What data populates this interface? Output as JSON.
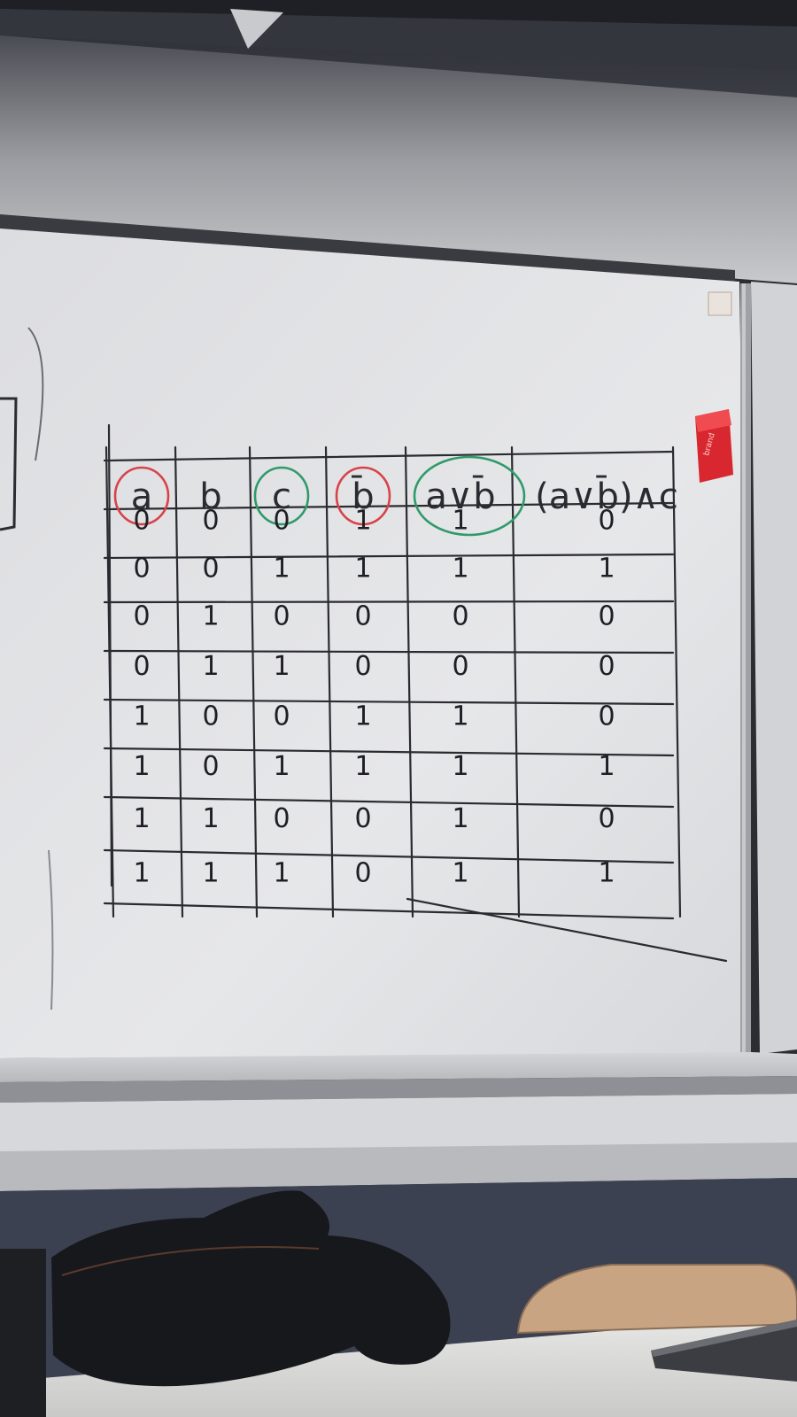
{
  "board": {
    "headers": [
      "a",
      "b",
      "c",
      "b̄",
      "a∨b̄",
      "(a∨b̄)∧c"
    ],
    "rows": [
      [
        "0",
        "0",
        "0",
        "1",
        "1",
        "0"
      ],
      [
        "0",
        "0",
        "1",
        "1",
        "1",
        "1"
      ],
      [
        "0",
        "1",
        "0",
        "0",
        "0",
        "0"
      ],
      [
        "0",
        "1",
        "1",
        "0",
        "0",
        "0"
      ],
      [
        "1",
        "0",
        "0",
        "1",
        "1",
        "0"
      ],
      [
        "1",
        "0",
        "1",
        "1",
        "1",
        "1"
      ],
      [
        "1",
        "1",
        "0",
        "0",
        "1",
        "0"
      ],
      [
        "1",
        "1",
        "1",
        "0",
        "1",
        "1"
      ]
    ],
    "highlighted_columns": [
      {
        "header": "a",
        "color": "#d9424a"
      },
      {
        "header": "c",
        "color": "#2f9a6a"
      },
      {
        "header": "b̄",
        "color": "#d9424a"
      },
      {
        "header": "a∨b̄",
        "color": "#2f9a6a"
      }
    ]
  },
  "eraser": {
    "color": "#d8272e"
  },
  "colors": {
    "board": "#e3e4e6",
    "wall": "#3b3d44",
    "ink": "#1e1f24"
  }
}
